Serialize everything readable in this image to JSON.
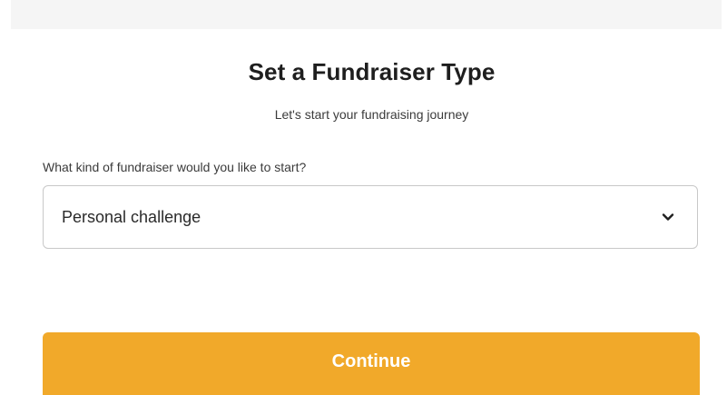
{
  "header": {
    "title": "Set a Fundraiser Type",
    "subtitle": "Let's start your fundraising journey"
  },
  "form": {
    "question_label": "What kind of fundraiser would you like to start?",
    "selected_option": "Personal challenge",
    "dropdown_icon": "chevron-down-icon"
  },
  "actions": {
    "continue_label": "Continue"
  },
  "colors": {
    "accent": "#f1a92a",
    "top_strip": "#f5f5f5",
    "border": "#c8c8c8"
  }
}
